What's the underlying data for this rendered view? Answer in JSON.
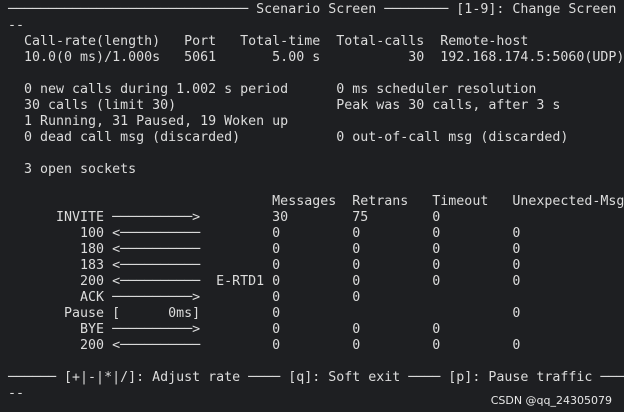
{
  "screen": {
    "header_line": "────────────────────────────── Scenario Screen ──────── [1-9]: Change Screen",
    "header_cont": "--",
    "stats_header": "  Call-rate(length)   Port   Total-time  Total-calls  Remote-host",
    "stats_values": "  10.0(0 ms)/1.000s   5061       5.00 s           30  192.168.174.5:5060(UDP)",
    "status_line_1": "  0 new calls during 1.002 s period      0 ms scheduler resolution",
    "status_line_2": "  30 calls (limit 30)                    Peak was 30 calls, after 3 s",
    "status_line_3": "  1 Running, 31 Paused, 19 Woken up",
    "status_line_4": "  0 dead call msg (discarded)            0 out-of-call msg (discarded)",
    "sockets_line": "  3 open sockets",
    "table_header": "                                 Messages  Retrans   Timeout   Unexpected-Msg",
    "rows": [
      "      INVITE ──────────>         30        75        0",
      "         100 <──────────         0         0         0         0",
      "         180 <──────────         0         0         0         0",
      "         183 <──────────         0         0         0         0",
      "         200 <──────────  E-RTD1 0         0         0         0",
      "         ACK ──────────>         0         0",
      "       Pause [      0ms]         0                             0",
      "         BYE ──────────>         0         0         0",
      "         200 <──────────         0         0         0         0"
    ],
    "footer_line": "────── [+|-|*|/]: Adjust rate ──── [q]: Soft exit ──── [p]: Pause traffic ───",
    "footer_cont": "--"
  },
  "watermark": "CSDN @qq_24305079",
  "colors": {
    "background": "#1e1f22",
    "text": "#dcdcdc"
  }
}
